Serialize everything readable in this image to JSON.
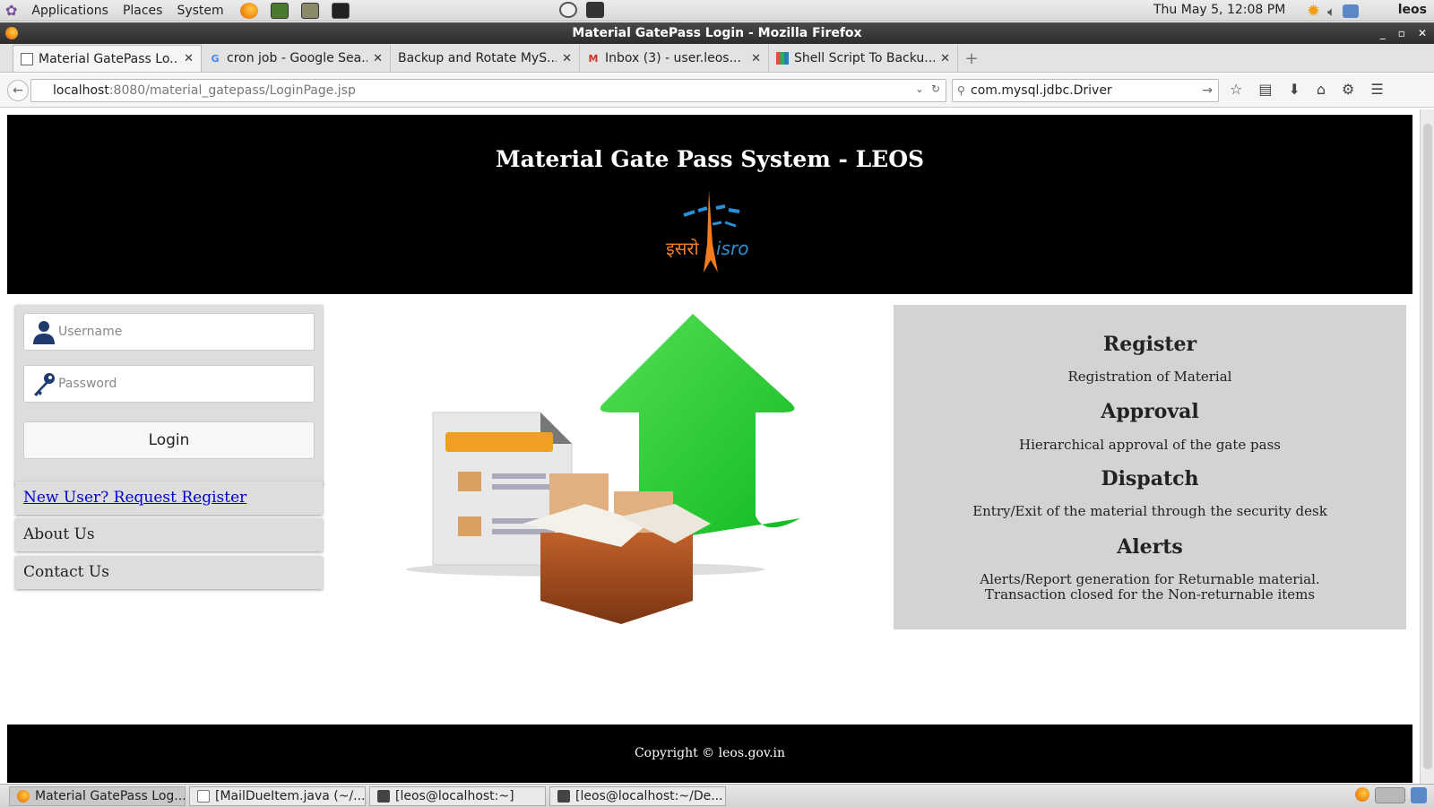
{
  "panel": {
    "menus": [
      "Applications",
      "Places",
      "System"
    ],
    "clock": "Thu May  5, 12:08 PM",
    "user": "leos"
  },
  "window": {
    "title": "Material GatePass Login - Mozilla Firefox"
  },
  "tabs": [
    {
      "label": "Material GatePass Lo...",
      "icon": "page-icon"
    },
    {
      "label": "cron job - Google Sea...",
      "icon": "google-icon"
    },
    {
      "label": "Backup and Rotate MyS...",
      "icon": "none"
    },
    {
      "label": "Inbox (3) - user.leos...",
      "icon": "gmail-icon"
    },
    {
      "label": "Shell Script To Backu...",
      "icon": "grid-icon"
    }
  ],
  "nav": {
    "url_host": "localhost",
    "url_path": ":8080/material_gatepass/LoginPage.jsp",
    "search_value": "com.mysql.jdbc.Driver"
  },
  "page": {
    "title": "Material Gate Pass System - LEOS",
    "login": {
      "username_placeholder": "Username",
      "password_placeholder": "Password",
      "button": "Login"
    },
    "links": {
      "register": "New User? Request Register",
      "about": "About Us",
      "contact": "Contact Us"
    },
    "features": [
      {
        "title": "Register",
        "desc": "Registration of Material"
      },
      {
        "title": "Approval",
        "desc": "Hierarchical approval of the gate pass"
      },
      {
        "title": "Dispatch",
        "desc": "Entry/Exit of the material through the security desk"
      },
      {
        "title": "Alerts",
        "desc_line1": "Alerts/Report generation for Returnable material.",
        "desc_line2": "Transaction closed for the Non-returnable items"
      }
    ],
    "footer": "Copyright © leos.gov.in",
    "logo_text": {
      "hindi": "इसरो",
      "latin": "isro"
    }
  },
  "taskbar": [
    "Material GatePass Log...",
    "[MailDueItem.java (~/...",
    "[leos@localhost:~]",
    "[leos@localhost:~/De..."
  ],
  "colors": {
    "header_bg": "#000000",
    "panel_bg": "#d3d3d3",
    "link": "#0000cc",
    "isro_orange": "#f47b20",
    "isro_blue": "#2a8fd6",
    "arrow_green": "#2ecc40"
  }
}
